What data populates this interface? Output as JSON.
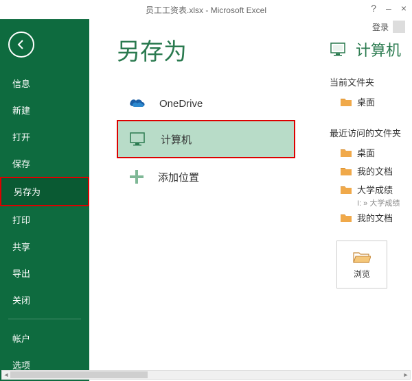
{
  "titlebar": {
    "title": "员工工资表.xlsx - Microsoft Excel",
    "help": "?",
    "minimize": "–",
    "close": "×",
    "login": "登录"
  },
  "sidebar": {
    "items": [
      {
        "label": "信息"
      },
      {
        "label": "新建"
      },
      {
        "label": "打开"
      },
      {
        "label": "保存"
      },
      {
        "label": "另存为"
      },
      {
        "label": "打印"
      },
      {
        "label": "共享"
      },
      {
        "label": "导出"
      },
      {
        "label": "关闭"
      }
    ],
    "bottom": [
      {
        "label": "帐户"
      },
      {
        "label": "选项"
      }
    ]
  },
  "main": {
    "title": "另存为",
    "locations": [
      {
        "label": "OneDrive"
      },
      {
        "label": "计算机"
      },
      {
        "label": "添加位置"
      }
    ]
  },
  "right": {
    "title": "计算机",
    "current_label": "当前文件夹",
    "recent_label": "最近访问的文件夹",
    "current": [
      {
        "label": "桌面"
      }
    ],
    "recent": [
      {
        "label": "桌面"
      },
      {
        "label": "我的文档"
      },
      {
        "label": "大学成绩",
        "sub": "I: » 大学成绩"
      },
      {
        "label": "我的文档"
      }
    ],
    "browse": "浏览"
  }
}
